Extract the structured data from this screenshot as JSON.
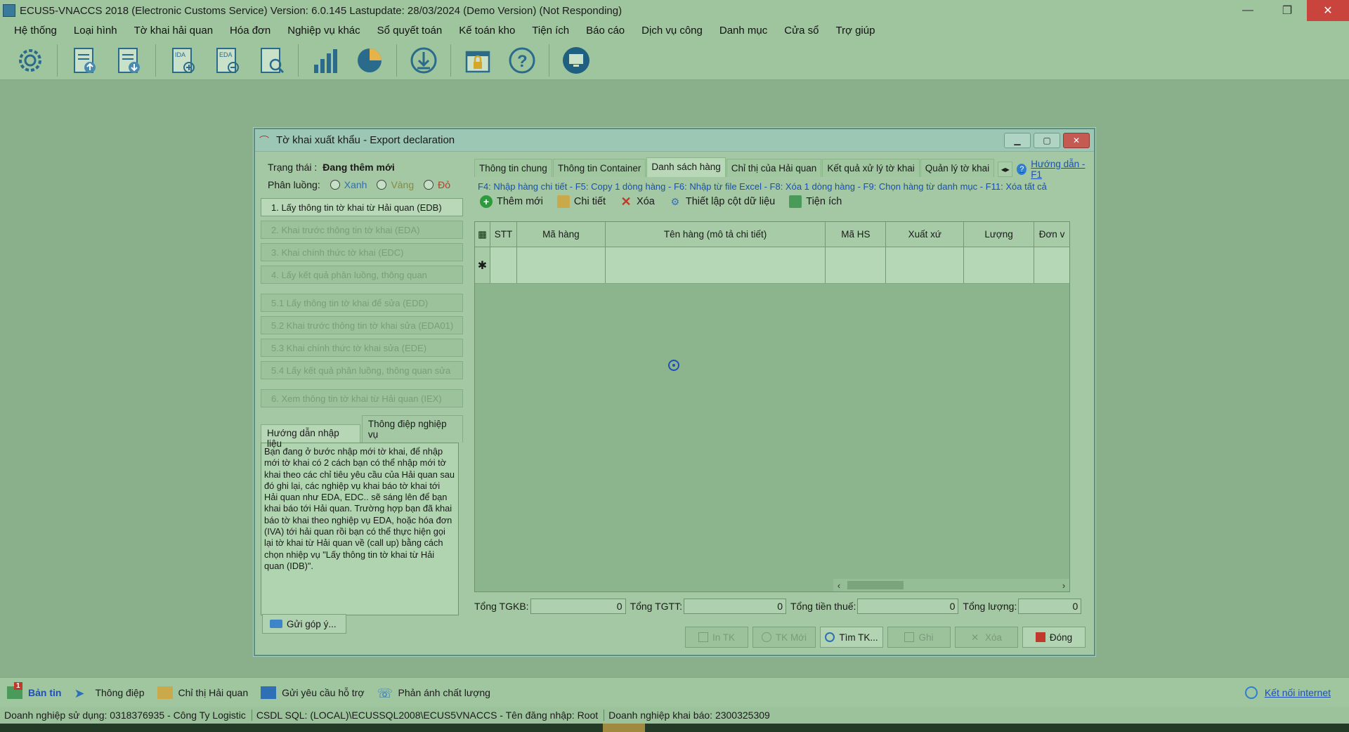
{
  "window": {
    "title": "ECUS5-VNACCS 2018 (Electronic Customs Service) Version: 6.0.145 Lastupdate: 28/03/2024 (Demo Version) (Not Responding)",
    "minimize": "—",
    "maximize": "❐",
    "close": "✕"
  },
  "menu": [
    "Hệ thống",
    "Loại hình",
    "Tờ khai hải quan",
    "Hóa đơn",
    "Nghiệp vụ khác",
    "Sổ quyết toán",
    "Kế toán kho",
    "Tiện ích",
    "Báo cáo",
    "Dịch vụ công",
    "Danh mục",
    "Cửa sổ",
    "Trợ giúp"
  ],
  "toolbar_icons": [
    "settings-icon",
    "export-declaration-icon",
    "import-declaration-icon",
    "ida-icon",
    "eda-icon",
    "search-document-icon",
    "bar-chart-icon",
    "pie-chart-icon",
    "download-icon",
    "lock-icon",
    "help-icon",
    "remote-support-icon"
  ],
  "dialog": {
    "title": "Tờ khai xuất khẩu - Export declaration",
    "status_label": "Trạng thái :",
    "status_value": "Đang thêm mới",
    "route_label": "Phân luồng:",
    "route_green": "Xanh",
    "route_yellow": "Vàng",
    "route_red": "Đỏ",
    "steps": [
      "1. Lấy thông tin tờ khai từ Hải quan (EDB)",
      "2. Khai trước thông tin tờ khai (EDA)",
      "3. Khai chính thức tờ khai (EDC)",
      "4. Lấy kết quả phân luồng, thông quan",
      "5.1 Lấy thông tin tờ khai để sửa (EDD)",
      "5.2 Khai trước thông tin tờ khai sửa (EDA01)",
      "5.3 Khai chính thức tờ khai sửa (EDE)",
      "5.4 Lấy kết quả phân luồng, thông quan sửa",
      "6. Xem thông tin tờ khai từ Hải quan (IEX)"
    ],
    "left_tabs": [
      "Hướng dẫn nhập liệu",
      "Thông điệp nghiệp vụ"
    ],
    "guide_text": "Bạn đang ở bước nhập mới tờ khai, để nhập mới tờ khai có 2 cách bạn có thể nhập mới tờ khai theo các chỉ tiêu yêu cầu của Hải quan sau đó ghi lại, các nghiệp vụ khai báo tờ khai tới Hải quan như EDA, EDC.. sẽ sáng lên để bạn khai báo tới Hải quan. Trường hợp bạn đã khai báo tờ khai theo nghiệp vụ EDA, hoặc hóa đơn (IVA) tới hải quan rồi bạn có thể thực hiện gọi lại tờ khai từ Hải quan về (call up) bằng cách chọn nhiệp vụ \"Lấy thông tin tờ khai từ Hải quan (IDB)\".",
    "feedback_button": "Gửi góp ý...",
    "tabs": [
      "Thông tin chung",
      "Thông tin Container",
      "Danh sách hàng",
      "Chỉ thị của Hải quan",
      "Kết quả xử lý tờ khai",
      "Quản lý tờ khai"
    ],
    "help_link": "Hướng dẫn - F1",
    "hotkeys": "F4: Nhập hàng chi tiết - F5: Copy 1 dòng hàng - F6: Nhập từ file Excel - F8: Xóa 1 dòng hàng - F9: Chọn hàng từ danh mục - F11: Xóa tất cả",
    "actions": [
      "Thêm mới",
      "Chi tiết",
      "Xóa",
      "Thiết lập cột dữ liệu",
      "Tiện ích"
    ],
    "grid_columns": [
      "STT",
      "Mã hàng",
      "Tên hàng (mô tả chi tiết)",
      "Mã HS",
      "Xuất xứ",
      "Lượng",
      "Đơn v"
    ],
    "new_row_marker": "✱",
    "totals": {
      "tgkb_label": "Tổng TGKB:",
      "tgkb_value": "0",
      "tgtt_label": "Tổng TGTT:",
      "tgtt_value": "0",
      "tax_label": "Tổng tiền thuế:",
      "tax_value": "0",
      "qty_label": "Tổng lượng:",
      "qty_value": "0"
    },
    "buttons": [
      "In TK",
      "TK Mới",
      "Tìm TK...",
      "Ghi",
      "Xóa",
      "Đóng"
    ]
  },
  "statusbar": {
    "items": [
      "Bản tin",
      "Thông điệp",
      "Chỉ thị Hải quan",
      "Gửi yêu cầu hỗ trợ",
      "Phản ánh chất lượng"
    ],
    "news_badge": "1",
    "internet": "Kết nối internet",
    "company": "Doanh nghiệp sử dụng: 0318376935 - Công Ty Logistic",
    "db": "CSDL SQL: (LOCAL)\\ECUSSQL2008\\ECUS5VNACCS - Tên đăng nhập: Root",
    "declarer": "Doanh nghiệp khai báo: 2300325309"
  },
  "colors": {
    "overlay": "#89b08a",
    "link": "#1f4fb5",
    "close_red": "#c8443c"
  }
}
